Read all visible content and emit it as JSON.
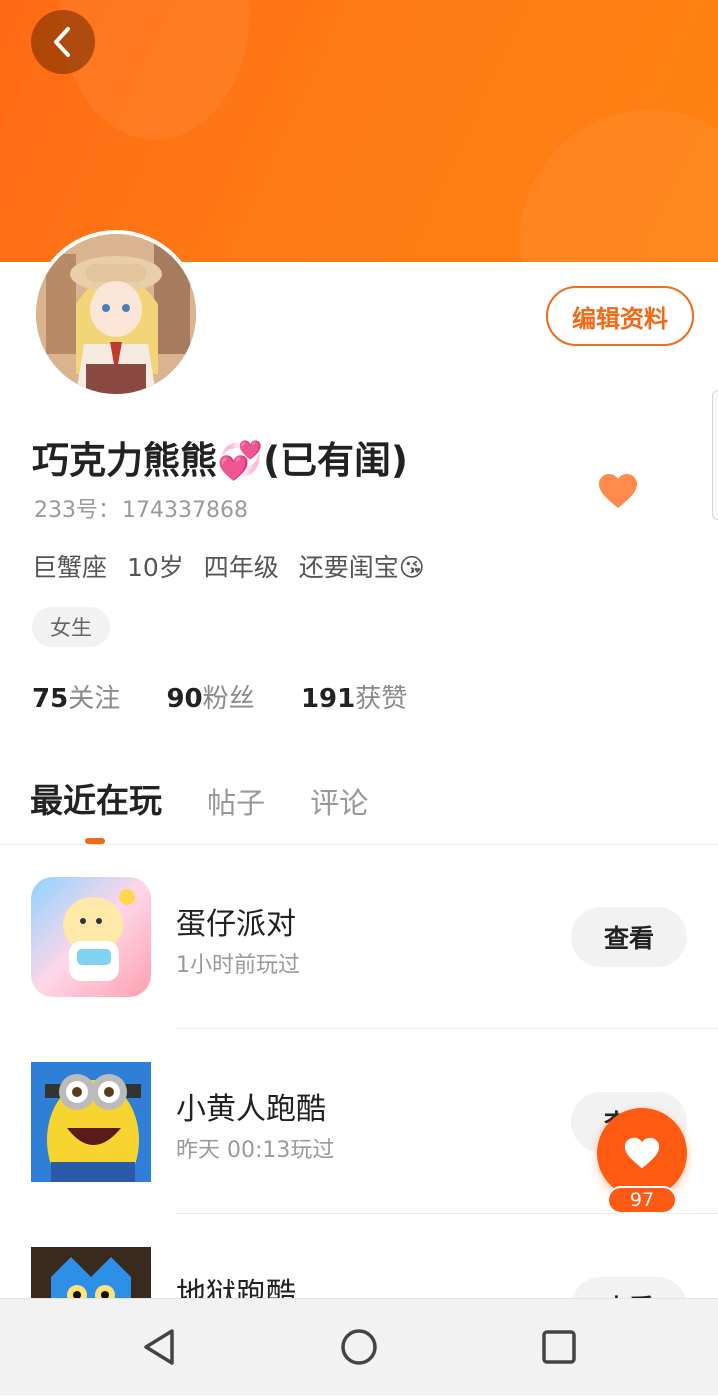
{
  "header": {
    "back_label": "‹"
  },
  "profile": {
    "edit_button": "编辑资料",
    "name": "巧克力熊熊💞(已有闺)",
    "uid_label": "233号：",
    "uid": "174337868",
    "bio": [
      "巨蟹座",
      "10岁",
      "四年级",
      "还要闺宝😘"
    ],
    "gender_tag": "女生",
    "stats": [
      {
        "value": "75",
        "label": "关注"
      },
      {
        "value": "90",
        "label": "粉丝"
      },
      {
        "value": "191",
        "label": "获赞"
      }
    ]
  },
  "tabs": [
    {
      "label": "最近在玩",
      "active": true
    },
    {
      "label": "帖子",
      "active": false
    },
    {
      "label": "评论",
      "active": false
    }
  ],
  "games": [
    {
      "title": "蛋仔派对",
      "time": "1小时前玩过",
      "action": "查看",
      "icon": "eggy-party-icon"
    },
    {
      "title": "小黄人跑酷",
      "time": "昨天 00:13玩过",
      "action": "查看",
      "icon": "minion-rush-icon"
    },
    {
      "title": "地狱跑酷",
      "time": "",
      "action": "查看",
      "icon": "hell-run-icon"
    }
  ],
  "fab": {
    "count": "97",
    "icon": "heart-icon"
  },
  "colors": {
    "accent": "#f06a1a",
    "header": "#ff7414",
    "fab": "#ff5a12"
  },
  "navbar": {
    "buttons": [
      "back-triangle-icon",
      "home-circle-icon",
      "recents-square-icon"
    ]
  }
}
